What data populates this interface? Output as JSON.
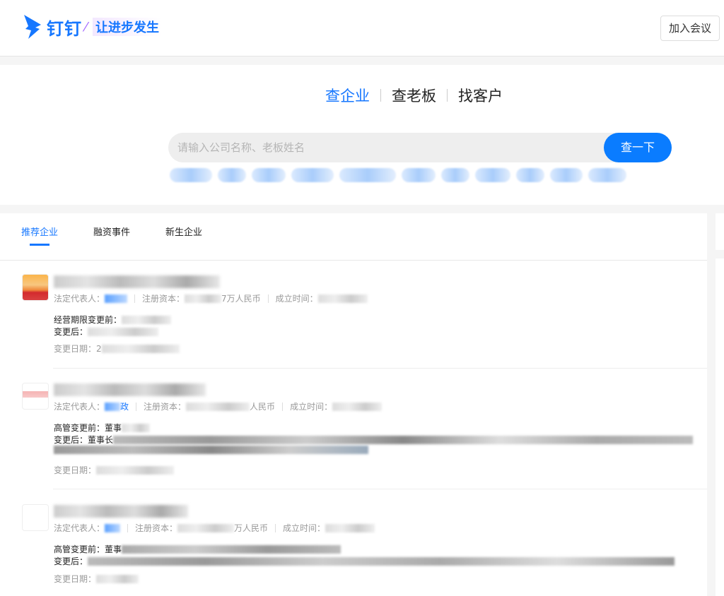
{
  "header": {
    "brand": "钉钉",
    "slogan": "让进步发生",
    "join_button": "加入会议"
  },
  "search": {
    "modes": [
      {
        "label": "查企业",
        "active": true
      },
      {
        "label": "查老板",
        "active": false
      },
      {
        "label": "找客户",
        "active": false
      }
    ],
    "placeholder": "请输入公司名称、老板姓名",
    "button": "查一下"
  },
  "tabs": [
    {
      "label": "推荐企业",
      "active": true
    },
    {
      "label": "融资事件"
    },
    {
      "label": "新生企业"
    }
  ],
  "labels": {
    "legal_rep": "法定代表人：",
    "capital": "注册资本：",
    "founded": "成立时间：",
    "change_date": "变更日期：",
    "after": "变更后："
  },
  "items": [
    {
      "capital_suffix": "7万人民币",
      "change_before_label": "经营期限变更前：",
      "date_prefix": "2"
    },
    {
      "rep_suffix": "政",
      "capital_suffix": "人民币",
      "change_before_label": "高管变更前：",
      "change_before_text": "董事",
      "after_prefix": "董事长"
    },
    {
      "capital_suffix": "万人民币",
      "change_before_label": "高管变更前：",
      "change_before_text": "董事"
    }
  ],
  "colors": {
    "accent": "#1677ff",
    "button": "#0a7cff"
  }
}
